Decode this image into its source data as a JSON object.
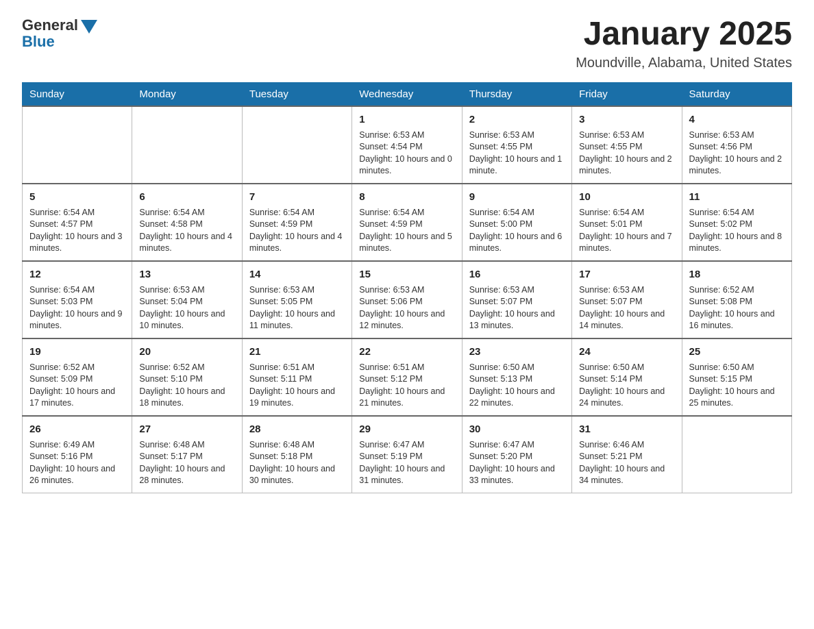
{
  "header": {
    "logo_general": "General",
    "logo_blue": "Blue",
    "month_title": "January 2025",
    "location": "Moundville, Alabama, United States"
  },
  "weekdays": [
    "Sunday",
    "Monday",
    "Tuesday",
    "Wednesday",
    "Thursday",
    "Friday",
    "Saturday"
  ],
  "weeks": [
    [
      {
        "day": "",
        "info": ""
      },
      {
        "day": "",
        "info": ""
      },
      {
        "day": "",
        "info": ""
      },
      {
        "day": "1",
        "info": "Sunrise: 6:53 AM\nSunset: 4:54 PM\nDaylight: 10 hours and 0 minutes."
      },
      {
        "day": "2",
        "info": "Sunrise: 6:53 AM\nSunset: 4:55 PM\nDaylight: 10 hours and 1 minute."
      },
      {
        "day": "3",
        "info": "Sunrise: 6:53 AM\nSunset: 4:55 PM\nDaylight: 10 hours and 2 minutes."
      },
      {
        "day": "4",
        "info": "Sunrise: 6:53 AM\nSunset: 4:56 PM\nDaylight: 10 hours and 2 minutes."
      }
    ],
    [
      {
        "day": "5",
        "info": "Sunrise: 6:54 AM\nSunset: 4:57 PM\nDaylight: 10 hours and 3 minutes."
      },
      {
        "day": "6",
        "info": "Sunrise: 6:54 AM\nSunset: 4:58 PM\nDaylight: 10 hours and 4 minutes."
      },
      {
        "day": "7",
        "info": "Sunrise: 6:54 AM\nSunset: 4:59 PM\nDaylight: 10 hours and 4 minutes."
      },
      {
        "day": "8",
        "info": "Sunrise: 6:54 AM\nSunset: 4:59 PM\nDaylight: 10 hours and 5 minutes."
      },
      {
        "day": "9",
        "info": "Sunrise: 6:54 AM\nSunset: 5:00 PM\nDaylight: 10 hours and 6 minutes."
      },
      {
        "day": "10",
        "info": "Sunrise: 6:54 AM\nSunset: 5:01 PM\nDaylight: 10 hours and 7 minutes."
      },
      {
        "day": "11",
        "info": "Sunrise: 6:54 AM\nSunset: 5:02 PM\nDaylight: 10 hours and 8 minutes."
      }
    ],
    [
      {
        "day": "12",
        "info": "Sunrise: 6:54 AM\nSunset: 5:03 PM\nDaylight: 10 hours and 9 minutes."
      },
      {
        "day": "13",
        "info": "Sunrise: 6:53 AM\nSunset: 5:04 PM\nDaylight: 10 hours and 10 minutes."
      },
      {
        "day": "14",
        "info": "Sunrise: 6:53 AM\nSunset: 5:05 PM\nDaylight: 10 hours and 11 minutes."
      },
      {
        "day": "15",
        "info": "Sunrise: 6:53 AM\nSunset: 5:06 PM\nDaylight: 10 hours and 12 minutes."
      },
      {
        "day": "16",
        "info": "Sunrise: 6:53 AM\nSunset: 5:07 PM\nDaylight: 10 hours and 13 minutes."
      },
      {
        "day": "17",
        "info": "Sunrise: 6:53 AM\nSunset: 5:07 PM\nDaylight: 10 hours and 14 minutes."
      },
      {
        "day": "18",
        "info": "Sunrise: 6:52 AM\nSunset: 5:08 PM\nDaylight: 10 hours and 16 minutes."
      }
    ],
    [
      {
        "day": "19",
        "info": "Sunrise: 6:52 AM\nSunset: 5:09 PM\nDaylight: 10 hours and 17 minutes."
      },
      {
        "day": "20",
        "info": "Sunrise: 6:52 AM\nSunset: 5:10 PM\nDaylight: 10 hours and 18 minutes."
      },
      {
        "day": "21",
        "info": "Sunrise: 6:51 AM\nSunset: 5:11 PM\nDaylight: 10 hours and 19 minutes."
      },
      {
        "day": "22",
        "info": "Sunrise: 6:51 AM\nSunset: 5:12 PM\nDaylight: 10 hours and 21 minutes."
      },
      {
        "day": "23",
        "info": "Sunrise: 6:50 AM\nSunset: 5:13 PM\nDaylight: 10 hours and 22 minutes."
      },
      {
        "day": "24",
        "info": "Sunrise: 6:50 AM\nSunset: 5:14 PM\nDaylight: 10 hours and 24 minutes."
      },
      {
        "day": "25",
        "info": "Sunrise: 6:50 AM\nSunset: 5:15 PM\nDaylight: 10 hours and 25 minutes."
      }
    ],
    [
      {
        "day": "26",
        "info": "Sunrise: 6:49 AM\nSunset: 5:16 PM\nDaylight: 10 hours and 26 minutes."
      },
      {
        "day": "27",
        "info": "Sunrise: 6:48 AM\nSunset: 5:17 PM\nDaylight: 10 hours and 28 minutes."
      },
      {
        "day": "28",
        "info": "Sunrise: 6:48 AM\nSunset: 5:18 PM\nDaylight: 10 hours and 30 minutes."
      },
      {
        "day": "29",
        "info": "Sunrise: 6:47 AM\nSunset: 5:19 PM\nDaylight: 10 hours and 31 minutes."
      },
      {
        "day": "30",
        "info": "Sunrise: 6:47 AM\nSunset: 5:20 PM\nDaylight: 10 hours and 33 minutes."
      },
      {
        "day": "31",
        "info": "Sunrise: 6:46 AM\nSunset: 5:21 PM\nDaylight: 10 hours and 34 minutes."
      },
      {
        "day": "",
        "info": ""
      }
    ]
  ]
}
